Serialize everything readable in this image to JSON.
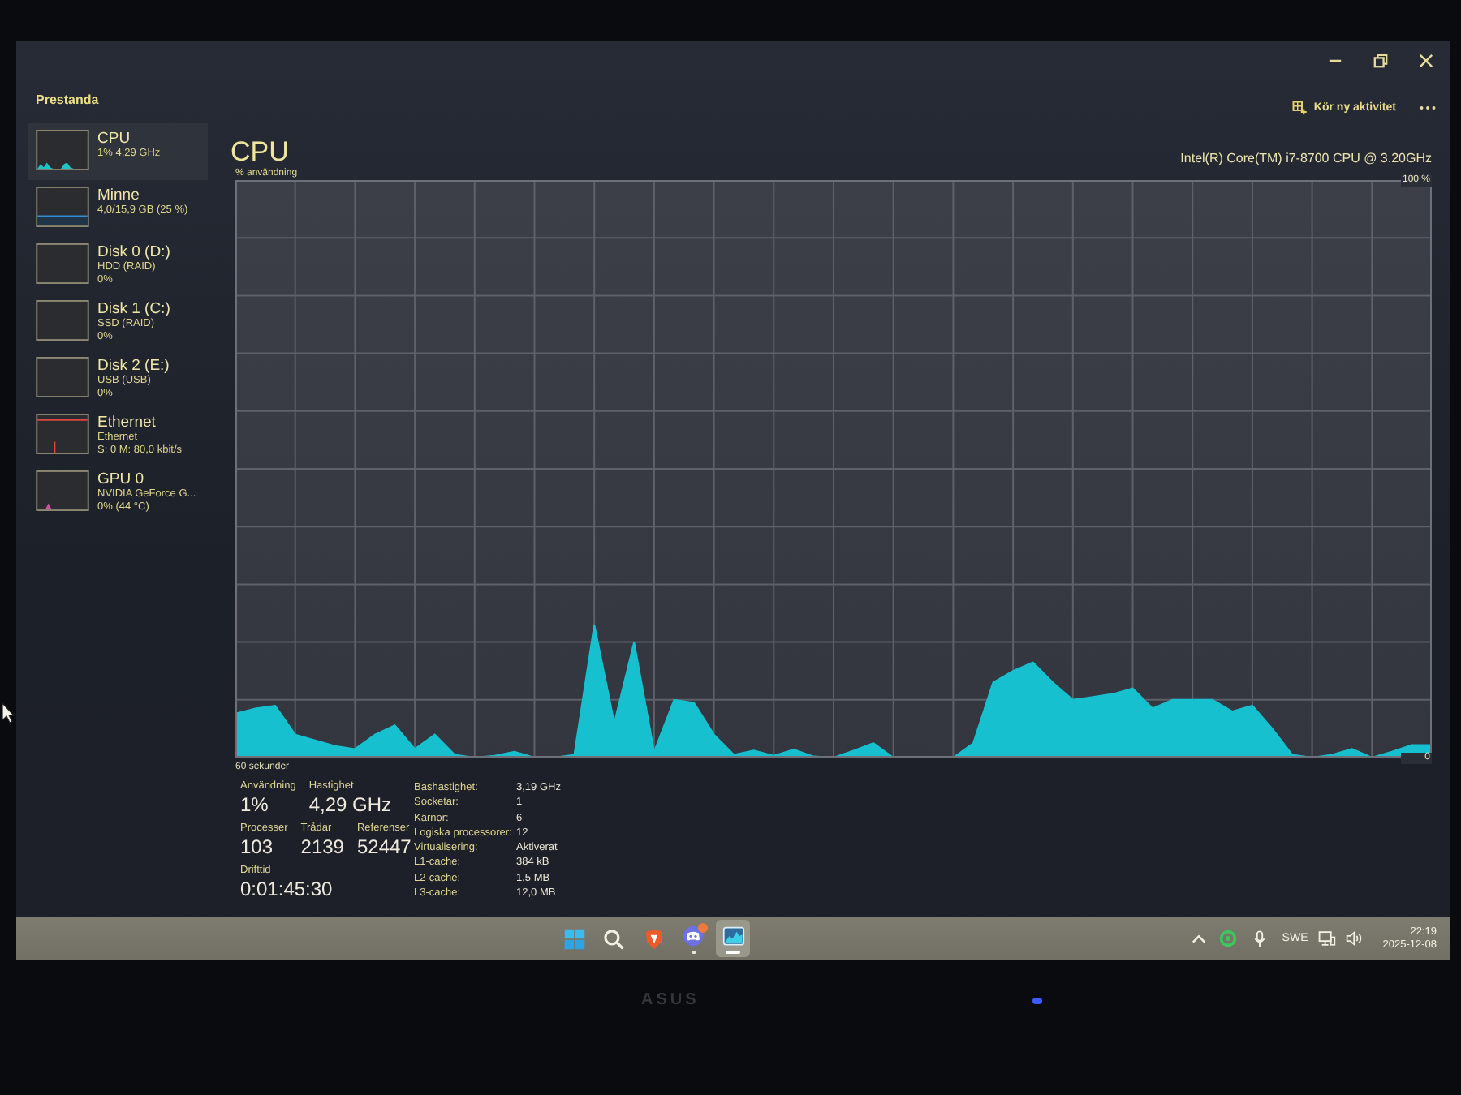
{
  "window": {
    "title": "Prestanda",
    "run_task": "Kör ny aktivitet"
  },
  "sidebar": {
    "items": [
      {
        "name": "CPU",
        "lines": [
          "1% 4,29 GHz"
        ],
        "kind": "cpu",
        "color": "#1ec3c8",
        "selected": true
      },
      {
        "name": "Minne",
        "lines": [
          "4,0/15,9 GB (25 %)"
        ],
        "kind": "memory",
        "color": "#2f8fd6",
        "selected": false
      },
      {
        "name": "Disk 0 (D:)",
        "lines": [
          "HDD (RAID)",
          "0%"
        ],
        "kind": "disk",
        "selected": false
      },
      {
        "name": "Disk 1 (C:)",
        "lines": [
          "SSD (RAID)",
          "0%"
        ],
        "kind": "disk",
        "selected": false
      },
      {
        "name": "Disk 2 (E:)",
        "lines": [
          "USB (USB)",
          "0%"
        ],
        "kind": "disk",
        "selected": false
      },
      {
        "name": "Ethernet",
        "lines": [
          "Ethernet",
          "S: 0 M: 80,0 kbit/s"
        ],
        "kind": "network",
        "color": "#e0453c",
        "selected": false
      },
      {
        "name": "GPU 0",
        "lines": [
          "NVIDIA GeForce G...",
          "0% (44 °C)"
        ],
        "kind": "gpu",
        "color": "#d24f9c",
        "selected": false
      }
    ]
  },
  "cpu_panel": {
    "title": "CPU",
    "processor": "Intel(R) Core(TM) i7-8700 CPU @ 3.20GHz",
    "chart_data": {
      "type": "area",
      "ylabel": "% användning",
      "xlabel": "60 sekunder",
      "grid": true,
      "ylim": [
        0,
        100
      ],
      "yticks": [
        {
          "value": 100,
          "label": "100 %"
        },
        {
          "value": 0,
          "label": "0"
        }
      ],
      "categories": [
        null,
        null,
        null,
        null,
        null,
        null,
        null,
        null,
        null,
        null,
        null,
        null,
        null,
        null,
        null,
        null,
        null,
        null,
        null,
        null,
        null,
        null,
        null,
        null,
        null,
        null,
        null,
        null,
        null,
        null,
        null,
        null,
        null,
        null,
        null,
        null,
        null,
        null,
        null,
        null,
        null,
        null,
        null,
        null,
        null,
        null,
        null,
        null,
        null,
        null,
        null,
        null,
        null,
        null,
        null,
        null,
        null,
        null,
        null,
        null,
        null
      ],
      "series": [
        {
          "color": "#17c0cf",
          "values": [
            7.6,
            8.5,
            9,
            4,
            3,
            2,
            1.5,
            4,
            5.6,
            1.5,
            4,
            0.5,
            0,
            0.3,
            1,
            0,
            0,
            0.5,
            23,
            6,
            20,
            1,
            10,
            9.5,
            4,
            0.5,
            1.2,
            0.3,
            1.4,
            0.2,
            0,
            1.2,
            2.5,
            0,
            0,
            0,
            0,
            2.5,
            13,
            15,
            16.5,
            13,
            10,
            10.5,
            11,
            12,
            8.5,
            10,
            10,
            10,
            8,
            9,
            5,
            0.5,
            0,
            0.5,
            1.5,
            0,
            1,
            2.2,
            2.2
          ]
        }
      ]
    },
    "stat_rows": [
      {
        "items": [
          {
            "label": "Användning",
            "value": "1%"
          },
          {
            "label": "Hastighet",
            "value": "4,29 GHz"
          }
        ]
      },
      {
        "items": [
          {
            "label": "Processer",
            "value": "103"
          },
          {
            "label": "Trådar",
            "value": "2139"
          },
          {
            "label": "Referenser",
            "value": "52447"
          }
        ]
      },
      {
        "items": [
          {
            "label": "Drifttid",
            "value": "0:01:45:30"
          }
        ]
      }
    ],
    "specs": [
      {
        "label": "Bashastighet:",
        "value": "3,19 GHz"
      },
      {
        "label": "Socketar:",
        "value": "1"
      },
      {
        "label": "Kärnor:",
        "value": "6"
      },
      {
        "label": "Logiska processorer:",
        "value": "12"
      },
      {
        "label": "Virtualisering:",
        "value": "Aktiverat"
      },
      {
        "label": "L1-cache:",
        "value": "384 kB"
      },
      {
        "label": "L2-cache:",
        "value": "1,5 MB"
      },
      {
        "label": "L3-cache:",
        "value": "12,0 MB"
      }
    ]
  },
  "taskbar": {
    "apps": [
      {
        "kind": "start",
        "running": false,
        "active": false,
        "badge": false
      },
      {
        "kind": "search",
        "running": false,
        "active": false,
        "badge": false
      },
      {
        "kind": "browser",
        "running": false,
        "active": false,
        "badge": false
      },
      {
        "kind": "chat",
        "running": true,
        "active": false,
        "badge": true
      },
      {
        "kind": "task-manager",
        "running": true,
        "active": true,
        "badge": false
      }
    ],
    "language": "SWE",
    "time": "22:19",
    "date": "2025-12-08"
  },
  "monitor": {
    "logo": "ASUS"
  }
}
